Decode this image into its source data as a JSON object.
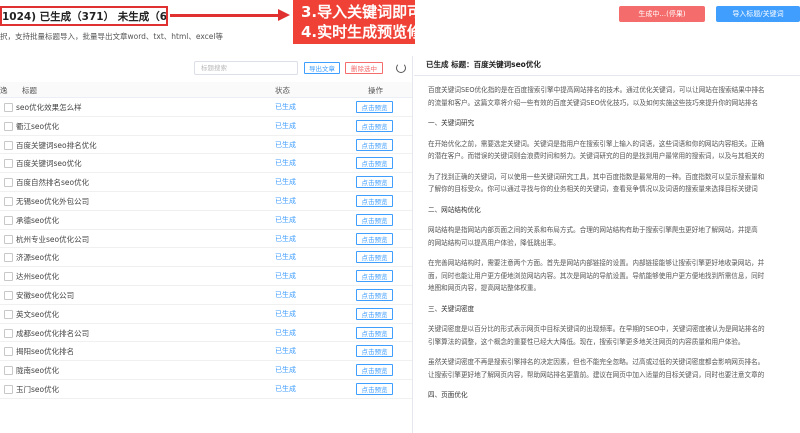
{
  "header": {
    "counts_text": "1024) 已生成（371） 未生成（653）",
    "hint": "択，支持批量标题导入，批量导出文章word、txt、html、excel等",
    "callout_line1": "3.导入关键词即可批量生成",
    "callout_line2": "4.实时生成预览修改导出",
    "generate_label": "生成中...(停果)",
    "import_label": "导入标题/关键词"
  },
  "toolbar": {
    "search_placeholder": "标题搜索",
    "export_label": "导出文章",
    "delete_label": "删除选中"
  },
  "table": {
    "col_title": "标题",
    "col_status": "状态",
    "col_action": "操作",
    "rows": [
      {
        "title": "seo优化效果怎么样",
        "status": "已生成",
        "action": "点击预览"
      },
      {
        "title": "衢江seo优化",
        "status": "已生成",
        "action": "点击预览"
      },
      {
        "title": "百度关键词seo排名优化",
        "status": "已生成",
        "action": "点击预览"
      },
      {
        "title": "百度关键词seo优化",
        "status": "已生成",
        "action": "点击预览"
      },
      {
        "title": "百度自然排名seo优化",
        "status": "已生成",
        "action": "点击预览"
      },
      {
        "title": "无锡seo优化外包公司",
        "status": "已生成",
        "action": "点击预览"
      },
      {
        "title": "承德seo优化",
        "status": "已生成",
        "action": "点击预览"
      },
      {
        "title": "杭州专业seo优化公司",
        "status": "已生成",
        "action": "点击预览"
      },
      {
        "title": "济源seo优化",
        "status": "已生成",
        "action": "点击预览"
      },
      {
        "title": "达州seo优化",
        "status": "已生成",
        "action": "点击预览"
      },
      {
        "title": "安徽seo优化公司",
        "status": "已生成",
        "action": "点击预览"
      },
      {
        "title": "英文seo优化",
        "status": "已生成",
        "action": "点击预览"
      },
      {
        "title": "成都seo优化排名公司",
        "status": "已生成",
        "action": "点击预览"
      },
      {
        "title": "揭阳seo优化排名",
        "status": "已生成",
        "action": "点击预览"
      },
      {
        "title": "陇南seo优化",
        "status": "已生成",
        "action": "点击预览"
      },
      {
        "title": "玉门seo优化",
        "status": "已生成",
        "action": "点击预览"
      }
    ]
  },
  "article": {
    "heading_label": "已生成 标题：百度关键词seo优化",
    "lines": [
      "百度关键词SEO优化指的是在百度搜索引擎中提高网站排名的技术。通过优化关键词，可以让网站在搜索结果中排名",
      "的流量和客户。这篇文章将介绍一些有效的百度关键词SEO优化技巧，以及如何实施这些技巧来提升你的网站排名",
      "",
      "一、关键词研究",
      "",
      "在开始优化之前，需要选定关键词。关键词是指用户在搜索引擎上输入的词语，这些词语和你的网站内容相关。正确",
      "的潜在客户。而错误的关键词则会浪费时间和努力。关键词研究的目的是找到用户最常用的搜索词，以及与其相关的",
      "",
      "为了找到正确的关键词，可以使用一些关键词研究工具，其中百度指数是最常用的一种。百度指数可以显示搜索量和",
      "了解你的目标受众。你可以通过寻找与你的业务相关的关键词，查看竞争情况以及词语的搜索量来选择目标关键词",
      "",
      "二、网站结构优化",
      "",
      "网站结构是指网站内部页面之间的关系和布局方式。合理的网站结构有助于搜索引擎爬虫更好地了解网站，并提高",
      "的网站结构可以提高用户体验，降低跳出率。",
      "",
      "在完善网站结构时，需要注意两个方面。首先是网站内部链接的设置。内部链接能够让搜索引擎更好地收录网站，并",
      "面，同时也能让用户更方便地浏览网站内容。其次是网站的导航设置。导航能够使用户更方便地找到所需信息，同时",
      "地图和网页内容，提高网站整体权重。",
      "",
      "三、关键词密度",
      "",
      "关键词密度是以百分比的形式表示网页中目标关键词的出现频率。在早期的SEO中，关键词密度被认为是网站排名的",
      "引擎算法的调整，这个概念的重要性已经大大降低。现在，搜索引擎更多地关注网页的内容质量和用户体验。",
      "",
      "虽然关键词密度不再是搜索引擎排名的决定因素，但也不能完全忽略。过高或过低的关键词密度都会影响网页排名。",
      "让搜索引擎更好地了解网页内容，帮助网站排名更靠前。建议在网页中加入适量的目标关键词，同时也要注意文章的",
      "",
      "四、页面优化"
    ]
  }
}
